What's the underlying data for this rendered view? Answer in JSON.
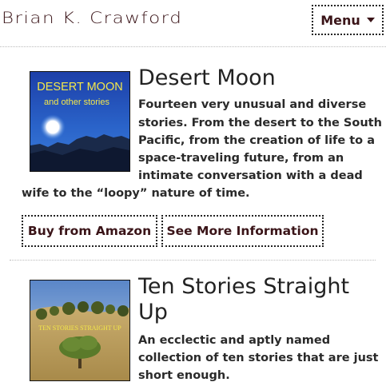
{
  "site": {
    "title": "Brian K. Crawford"
  },
  "menu": {
    "label": "Menu"
  },
  "books": [
    {
      "title": "Desert Moon",
      "cover": {
        "title_line1": "DESERT MOON",
        "title_line2": "and other stories"
      },
      "description_lines": [
        "Fourteen very unusual and diverse",
        "stories. From the desert to the South",
        "Pacific, from the creation of life to a",
        "space-traveling future, from an",
        "intimate conversation with a dead",
        "wife to the “loopy” nature of time."
      ],
      "buttons": {
        "buy": "Buy from Amazon",
        "info": "See More Information"
      }
    },
    {
      "title_line1": "Ten Stories Straight",
      "title_line2": "Up",
      "cover": {
        "title": "TEN STORIES STRAIGHT UP"
      },
      "description_lines": [
        "An ecclectic and aptly named",
        "collection of ten stories that are just",
        "short enough."
      ]
    }
  ]
}
